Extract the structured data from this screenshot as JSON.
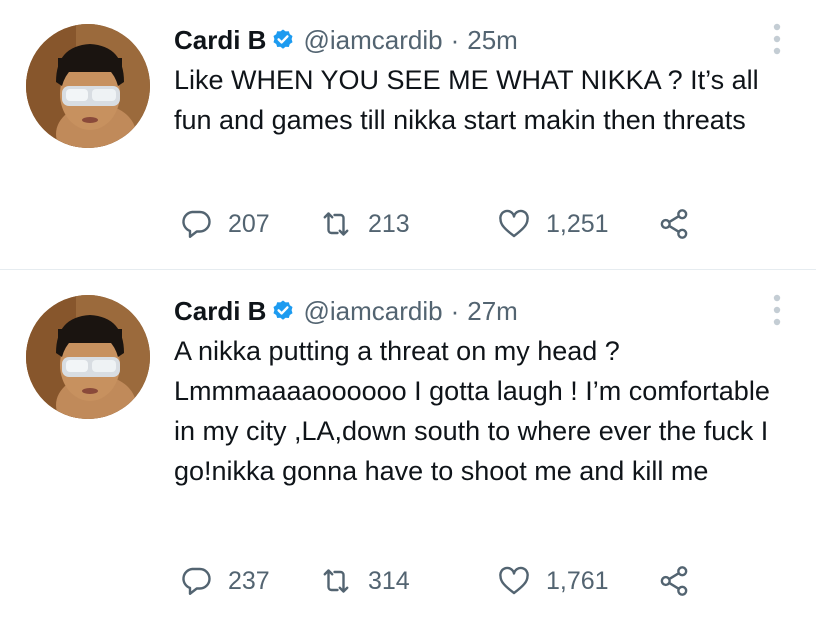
{
  "tweets": [
    {
      "name": "Cardi B",
      "handle": "@iamcardib",
      "separator": "·",
      "time": "25m",
      "text": "Like WHEN YOU SEE ME WHAT NIKKA ? It’s all fun and games till nikka start makin then threats",
      "replies": "207",
      "retweets": "213",
      "likes": "1,251"
    },
    {
      "name": "Cardi B",
      "handle": "@iamcardib",
      "separator": "·",
      "time": "27m",
      "text": "A nikka putting a threat on my head ? Lmmmaaaaoooooo I gotta laugh ! I’m comfortable in my city ,LA,down south to where ever the fuck I go!nikka gonna have to shoot me and kill me",
      "replies": "237",
      "retweets": "314",
      "likes": "1,761"
    }
  ],
  "icons": {
    "verified": "verified-badge-icon",
    "more": "more-vertical-icon",
    "reply": "reply-icon",
    "retweet": "retweet-icon",
    "like": "heart-icon",
    "share": "share-icon"
  },
  "colors": {
    "verified_blue": "#1d9bf0",
    "secondary_text": "#536471",
    "primary_text": "#0f1419",
    "divider": "#e6ecf0"
  }
}
